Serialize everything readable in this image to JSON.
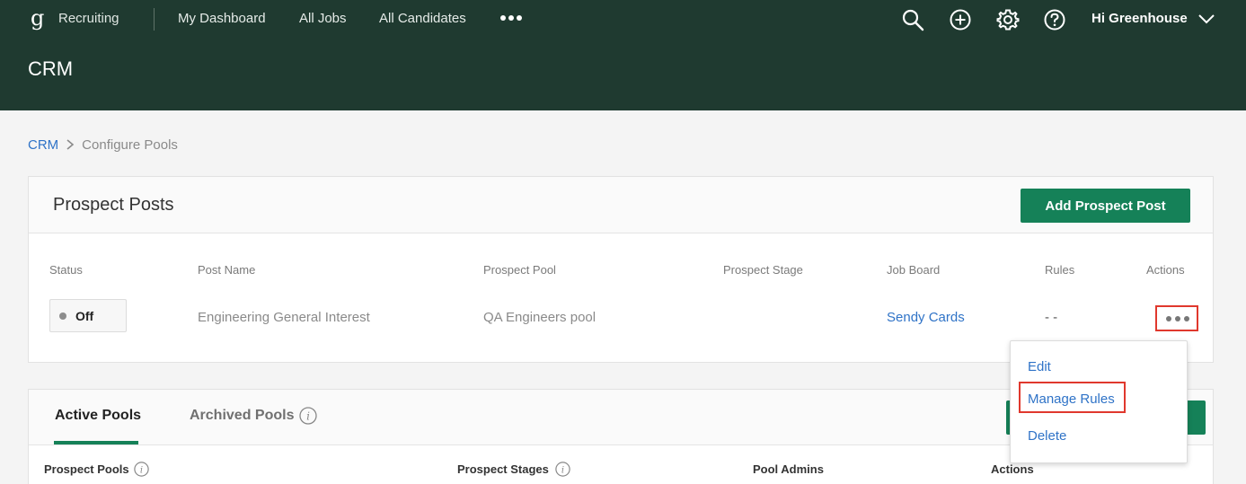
{
  "nav": {
    "logo_glyph": "g",
    "brand": "Recruiting",
    "links": [
      "My Dashboard",
      "All Jobs",
      "All Candidates"
    ],
    "more_icon": "ellipsis-icon",
    "icons": [
      "search-icon",
      "add-icon",
      "gear-icon",
      "help-icon"
    ],
    "user_greeting": "Hi Greenhouse"
  },
  "page": {
    "title": "CRM"
  },
  "breadcrumb": {
    "root": "CRM",
    "current": "Configure Pools"
  },
  "prospect_posts": {
    "title": "Prospect Posts",
    "add_button": "Add Prospect Post",
    "columns": [
      "Status",
      "Post Name",
      "Prospect Pool",
      "Prospect Stage",
      "Job Board",
      "Rules",
      "Actions"
    ],
    "rows": [
      {
        "status": "Off",
        "post_name": "Engineering General Interest",
        "prospect_pool": "QA Engineers pool",
        "prospect_stage": "",
        "job_board": "Sendy Cards",
        "rules": "- -"
      }
    ]
  },
  "actions_menu": {
    "items": [
      "Edit",
      "Manage Rules",
      "Delete"
    ]
  },
  "pools": {
    "tabs": [
      "Active Pools",
      "Archived Pools"
    ],
    "columns": [
      "Prospect Pools",
      "Prospect Stages",
      "Pool Admins",
      "Actions"
    ]
  },
  "colors": {
    "header_bg": "#1f3a30",
    "primary_green": "#158158",
    "link_blue": "#2f73c7",
    "highlight_red": "#e0382d"
  }
}
